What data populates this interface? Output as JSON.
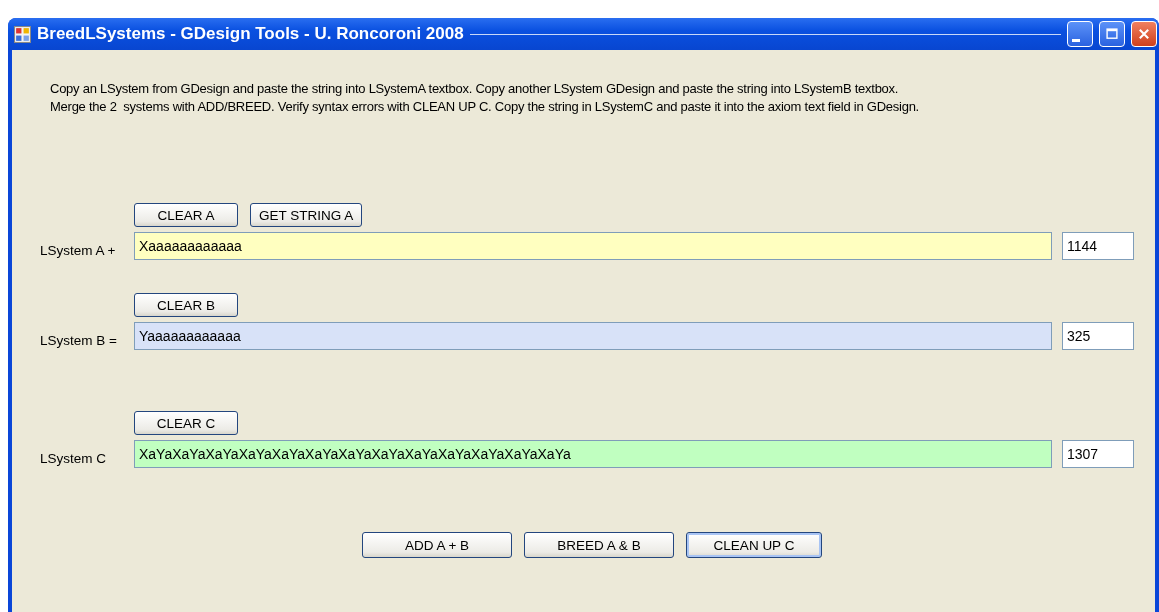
{
  "window": {
    "title": "BreedLSystems - GDesign Tools - U. Roncoroni 2008"
  },
  "instructions": [
    "Copy an LSystem from GDesign and paste the string into LSystemA textbox. Copy another LSystem GDesign and paste the string into LSystemB textbox.",
    "Merge the 2  systems with ADD/BREED. Verify syntax errors with CLEAN UP C. Copy the string in LSystemC and paste it into the axiom text field in GDesign."
  ],
  "systems": [
    {
      "label": "LSystem A +",
      "buttons": [
        "CLEAR A",
        "GET STRING A"
      ],
      "value": "Xaaaaaaaaaaaa",
      "count": "1144",
      "color": "#ffffc0"
    },
    {
      "label": "LSystem B =",
      "buttons": [
        "CLEAR B"
      ],
      "value": "Yaaaaaaaaaaaa",
      "count": "325",
      "color": "#d8e2f8"
    },
    {
      "label": "LSystem C",
      "buttons": [
        "CLEAR C"
      ],
      "value": "XaYaXaYaXaYaXaYaXaYaXaYaXaYaXaYaXaYaXaYaXaYaXaYaXaYa",
      "count": "1307",
      "color": "#c0ffc0"
    }
  ],
  "actions": [
    {
      "label": "ADD A + B",
      "focused": false
    },
    {
      "label": "BREED A & B",
      "focused": false
    },
    {
      "label": "CLEAN UP C",
      "focused": true
    }
  ]
}
